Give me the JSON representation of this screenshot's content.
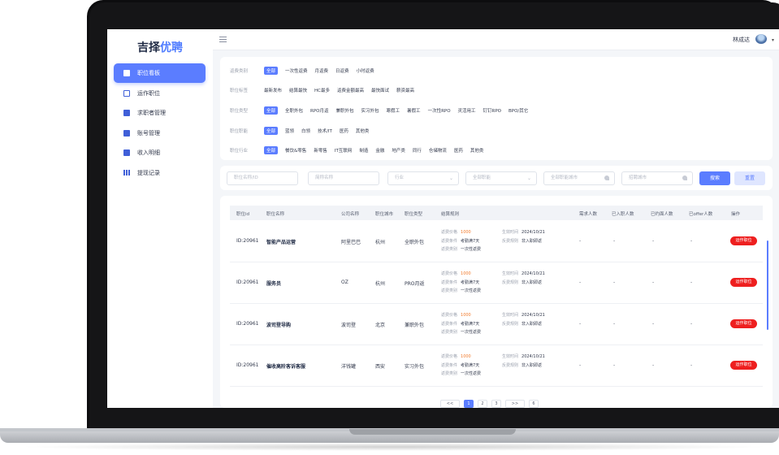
{
  "sidebar": {
    "logo_main": "吉择",
    "logo_accent": "优聘",
    "items": [
      {
        "label": "职位看板"
      },
      {
        "label": "运作职位"
      },
      {
        "label": "求职者管理"
      },
      {
        "label": "账号管理"
      },
      {
        "label": "收入明细"
      },
      {
        "label": "提现记录"
      }
    ]
  },
  "header": {
    "user_name": "林成达"
  },
  "filters": {
    "rows": [
      {
        "label": "返费类别",
        "options": [
          "全部",
          "一次性返费",
          "月返费",
          "日返费",
          "小时返费"
        ]
      },
      {
        "label": "职位标签",
        "options": [
          "最新发布",
          "结算最快",
          "HC最多",
          "返费金额最高",
          "最快面试",
          "薪资最高"
        ]
      },
      {
        "label": "职位类型",
        "options": [
          "全部",
          "全职外包",
          "RPO月返",
          "兼职外包",
          "实习外包",
          "寒假工",
          "暑假工",
          "一次性RPO",
          "灵活用工",
          "钉钉RPO",
          "BPO/其它"
        ]
      },
      {
        "label": "职位职能",
        "options": [
          "全部",
          "蓝领",
          "白领",
          "技术/IT",
          "医药",
          "其他类"
        ]
      },
      {
        "label": "职位行业",
        "options": [
          "全部",
          "餐饮&零售",
          "新零售",
          "IT互联网",
          "制造",
          "金融",
          "地产类",
          "同行",
          "仓储物流",
          "医药",
          "其他类"
        ]
      }
    ]
  },
  "search": {
    "position_name": "职位名称/ID",
    "company_name": "简称名称",
    "industry": "行业",
    "job_function": "全部职能",
    "work_city": "全部职能城市",
    "recruit_city": "招聘城市",
    "search_btn": "搜索",
    "reset_btn": "重置"
  },
  "table": {
    "headers": [
      "职位id",
      "职位名称",
      "公司名称",
      "职位城市",
      "职位类型",
      "结算规则",
      "需求人数",
      "已入职人数",
      "已约面人数",
      "已offer人数",
      "操作"
    ],
    "rule_labels": [
      "返费价格",
      "返费条件",
      "返费类别",
      "生效时间",
      "反费规则"
    ],
    "rows": [
      {
        "id": "ID:20961",
        "name": "智能产品运营",
        "company": "阿里巴巴",
        "city": "杭州",
        "type": "全职外包",
        "price": "1000",
        "condition": "考勤满7天",
        "category": "一次性返费",
        "effective": "2024/10/21",
        "rule": "非入职即返",
        "need": "-",
        "hired": "-",
        "interview": "-",
        "offer": "-",
        "action": "运作职位"
      },
      {
        "id": "ID:20961",
        "name": "服务员",
        "company": "OZ",
        "city": "杭州",
        "type": "PRO月返",
        "price": "1000",
        "condition": "考勤满7天",
        "category": "一次性返费",
        "effective": "2024/10/21",
        "rule": "非入职即返",
        "need": "-",
        "hired": "-",
        "interview": "-",
        "offer": "-",
        "action": "运作职位"
      },
      {
        "id": "ID:20961",
        "name": "波司登导购",
        "company": "波司登",
        "city": "北京",
        "type": "兼职外包",
        "price": "1000",
        "condition": "考勤满7天",
        "category": "一次性返费",
        "effective": "2024/10/21",
        "rule": "非入职即返",
        "need": "-",
        "hired": "-",
        "interview": "-",
        "offer": "-",
        "action": "运作职位"
      },
      {
        "id": "ID:20961",
        "name": "催收高阶客诉客服",
        "company": "洋钱罐",
        "city": "西安",
        "type": "实习外包",
        "price": "1000",
        "condition": "考勤满7天",
        "category": "一次性返费",
        "effective": "2024/10/21",
        "rule": "非入职即返",
        "need": "-",
        "hired": "-",
        "interview": "-",
        "offer": "-",
        "action": "运作职位"
      }
    ]
  },
  "pagination": {
    "prev": "<<",
    "pages": [
      "1",
      "2",
      "3"
    ],
    "next": ">>",
    "total": "6",
    "current": "1"
  }
}
